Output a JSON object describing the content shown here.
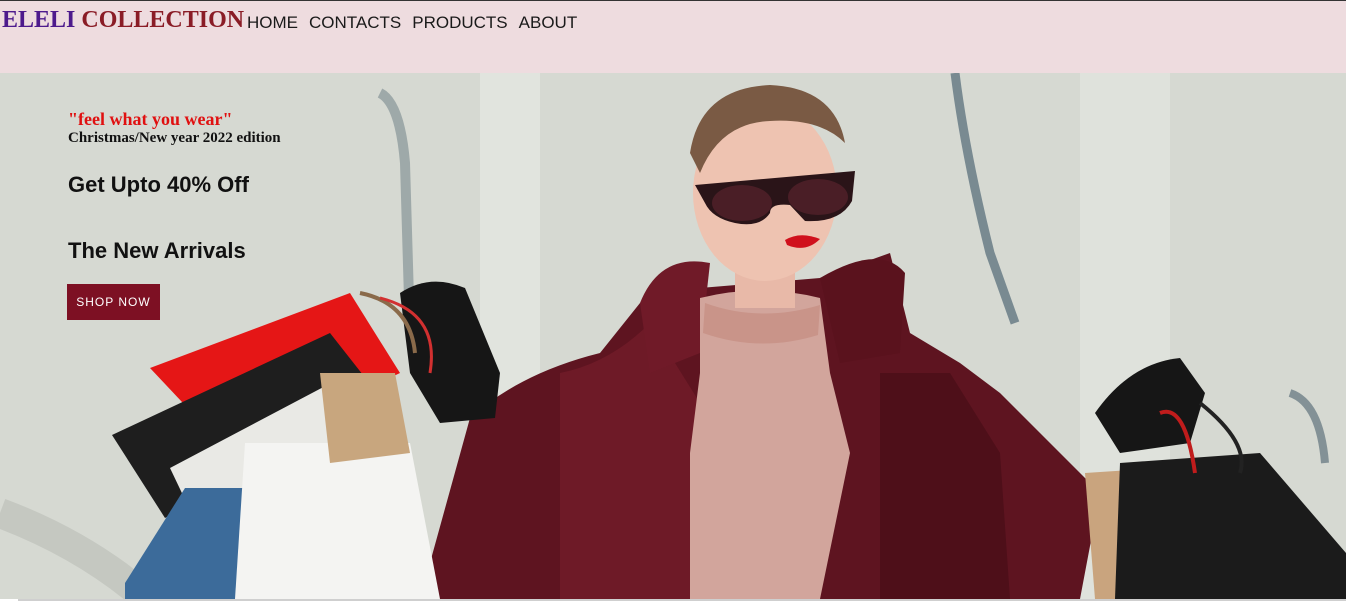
{
  "brand": {
    "part1": "ELELI",
    "part2": "COLLECTION"
  },
  "nav": {
    "home": "HOME",
    "contacts": "CONTACTS",
    "products": "PRODUCTS",
    "about": "ABOUT"
  },
  "hero": {
    "tagline": "\"feel what you wear\"",
    "edition": "Christmas/New year 2022 edition",
    "offer": "Get Upto 40% Off",
    "arrivals": "The New Arrivals",
    "shop_button": "SHOP NOW"
  },
  "colors": {
    "header_bg": "#eedcdf",
    "brand_purple": "#4d1a8c",
    "brand_red": "#8a1c26",
    "button_bg": "#7d1023",
    "tagline_red": "#e01010"
  }
}
